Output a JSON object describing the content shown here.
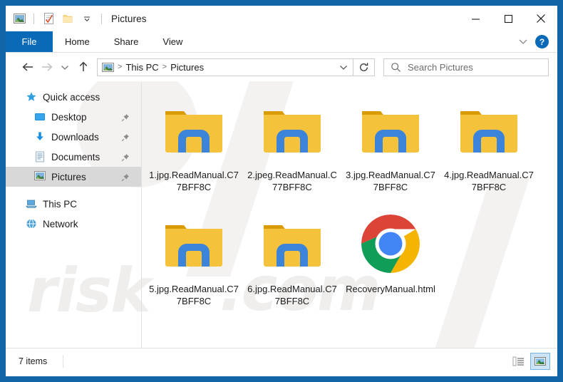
{
  "window": {
    "title": "Pictures",
    "quick_access_icons": [
      "picture-icon",
      "properties-icon",
      "new-folder-icon",
      "customize-chevron-icon"
    ],
    "controls": {
      "minimize": "Minimize",
      "maximize": "Maximize",
      "close": "Close"
    }
  },
  "ribbon": {
    "file_label": "File",
    "tabs": [
      "Home",
      "Share",
      "View"
    ],
    "collapse_label": "Collapse the Ribbon",
    "help_label": "?"
  },
  "address": {
    "back": "Back",
    "forward": "Forward",
    "recent": "Recent locations",
    "up": "Up",
    "breadcrumbs": [
      "This PC",
      "Pictures"
    ],
    "separator": ">",
    "dropdown": "Previous locations",
    "refresh": "Refresh"
  },
  "search": {
    "placeholder": "Search Pictures",
    "icon": "search-icon"
  },
  "sidebar": {
    "items": [
      {
        "label": "Quick access",
        "icon": "star-icon",
        "sub": false,
        "pinned": false,
        "selected": false
      },
      {
        "label": "Desktop",
        "icon": "desktop-icon",
        "sub": true,
        "pinned": true,
        "selected": false
      },
      {
        "label": "Downloads",
        "icon": "download-icon",
        "sub": true,
        "pinned": true,
        "selected": false
      },
      {
        "label": "Documents",
        "icon": "documents-icon",
        "sub": true,
        "pinned": true,
        "selected": false
      },
      {
        "label": "Pictures",
        "icon": "pictures-icon",
        "sub": true,
        "pinned": true,
        "selected": true
      },
      {
        "label": "This PC",
        "icon": "this-pc-icon",
        "sub": false,
        "pinned": false,
        "selected": false
      },
      {
        "label": "Network",
        "icon": "network-icon",
        "sub": false,
        "pinned": false,
        "selected": false
      }
    ]
  },
  "files": [
    {
      "name": "1.jpg.ReadManual.C77BFF8C",
      "icon": "encrypted-file-icon"
    },
    {
      "name": "2.jpeg.ReadManual.C77BFF8C",
      "icon": "encrypted-file-icon"
    },
    {
      "name": "3.jpg.ReadManual.C77BFF8C",
      "icon": "encrypted-file-icon"
    },
    {
      "name": "4.jpg.ReadManual.C77BFF8C",
      "icon": "encrypted-file-icon"
    },
    {
      "name": "5.jpg.ReadManual.C77BFF8C",
      "icon": "encrypted-file-icon"
    },
    {
      "name": "6.jpg.ReadManual.C77BFF8C",
      "icon": "encrypted-file-icon"
    },
    {
      "name": "RecoveryManual.html",
      "icon": "chrome-icon"
    }
  ],
  "status": {
    "item_count": "7 items",
    "details_view": "Details view",
    "large_icons_view": "Large icons view"
  },
  "watermark": {
    "left": "risk",
    "right": ".com"
  },
  "colors": {
    "frame_blue": "#1266a8",
    "file_tab_blue": "#0b6ab8",
    "selection_gray": "#d8d8d8",
    "view_active_blue": "#cce4f6",
    "folder_yellow": "#f5c33b",
    "folder_tab_gold": "#d99b06",
    "icon_blue": "#3b84d9"
  }
}
